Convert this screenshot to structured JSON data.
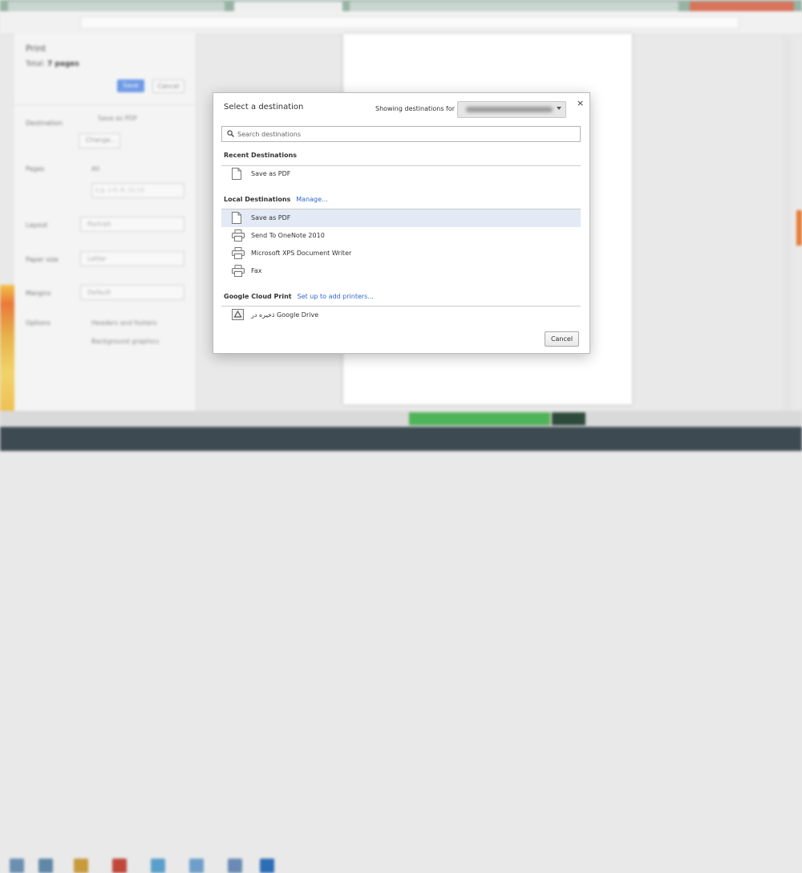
{
  "background": {
    "print_panel": {
      "title": "Print",
      "total_label": "Total:",
      "total_value": "7 pages",
      "save_label": "Save",
      "cancel_label": "Cancel",
      "destination_label": "Destination",
      "destination_value": "Save as PDF",
      "change_label": "Change...",
      "pages_label": "Pages",
      "pages_all": "All",
      "pages_placeholder": "e.g. 1-5, 8, 11-13",
      "layout_label": "Layout",
      "layout_value": "Portrait",
      "paper_label": "Paper size",
      "paper_value": "Letter",
      "margins_label": "Margins",
      "margins_value": "Default",
      "options_label": "Options",
      "option_headers": "Headers and footers",
      "option_background": "Background graphics"
    }
  },
  "dialog": {
    "title": "Select a destination",
    "showing_label": "Showing destinations for",
    "search_placeholder": "Search destinations",
    "close_glyph": "×",
    "recent": {
      "heading": "Recent Destinations",
      "items": [
        {
          "label": "Save as PDF",
          "icon": "document-icon"
        }
      ]
    },
    "local": {
      "heading": "Local Destinations",
      "manage_label": "Manage...",
      "items": [
        {
          "label": "Save as PDF",
          "icon": "document-icon",
          "selected": true
        },
        {
          "label": "Send To OneNote 2010",
          "icon": "printer-icon"
        },
        {
          "label": "Microsoft XPS Document Writer",
          "icon": "printer-icon"
        },
        {
          "label": "Fax",
          "icon": "printer-icon"
        }
      ]
    },
    "cloud": {
      "heading": "Google Cloud Print",
      "setup_label": "Set up to add printers...",
      "items": [
        {
          "label": "ذخیره در Google Drive",
          "icon": "google-drive-icon"
        }
      ]
    },
    "cancel_label": "Cancel"
  },
  "colors": {
    "link": "#3366cc",
    "selected_row": "#e3eaf5",
    "save_button": "#6e9ae6"
  }
}
